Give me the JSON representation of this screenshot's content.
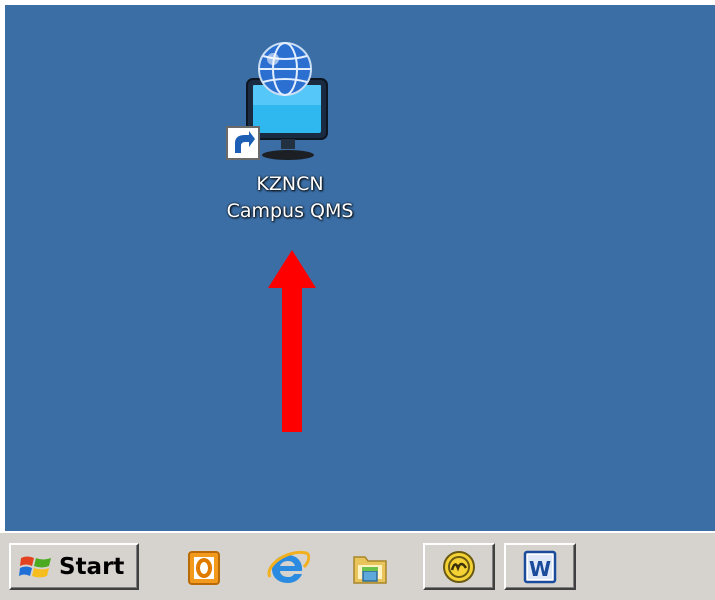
{
  "desktop": {
    "background_color": "#3b6ea5",
    "icons": [
      {
        "icon": "globe-monitor-shortcut-icon",
        "label_line1": "KZNCN",
        "label_line2": "Campus QMS"
      }
    ],
    "annotation": {
      "icon": "red-arrow-up-icon",
      "color": "#ff0000"
    }
  },
  "taskbar": {
    "background_color": "#d6d3ce",
    "start_label": "Start",
    "start_icon": "windows-flag-icon",
    "quick_launch": [
      {
        "icon": "outlook-icon"
      },
      {
        "icon": "internet-explorer-icon"
      },
      {
        "icon": "file-explorer-icon"
      }
    ],
    "running_apps": [
      {
        "icon": "fw-app-icon"
      },
      {
        "icon": "word-icon",
        "letter": "W"
      }
    ]
  }
}
